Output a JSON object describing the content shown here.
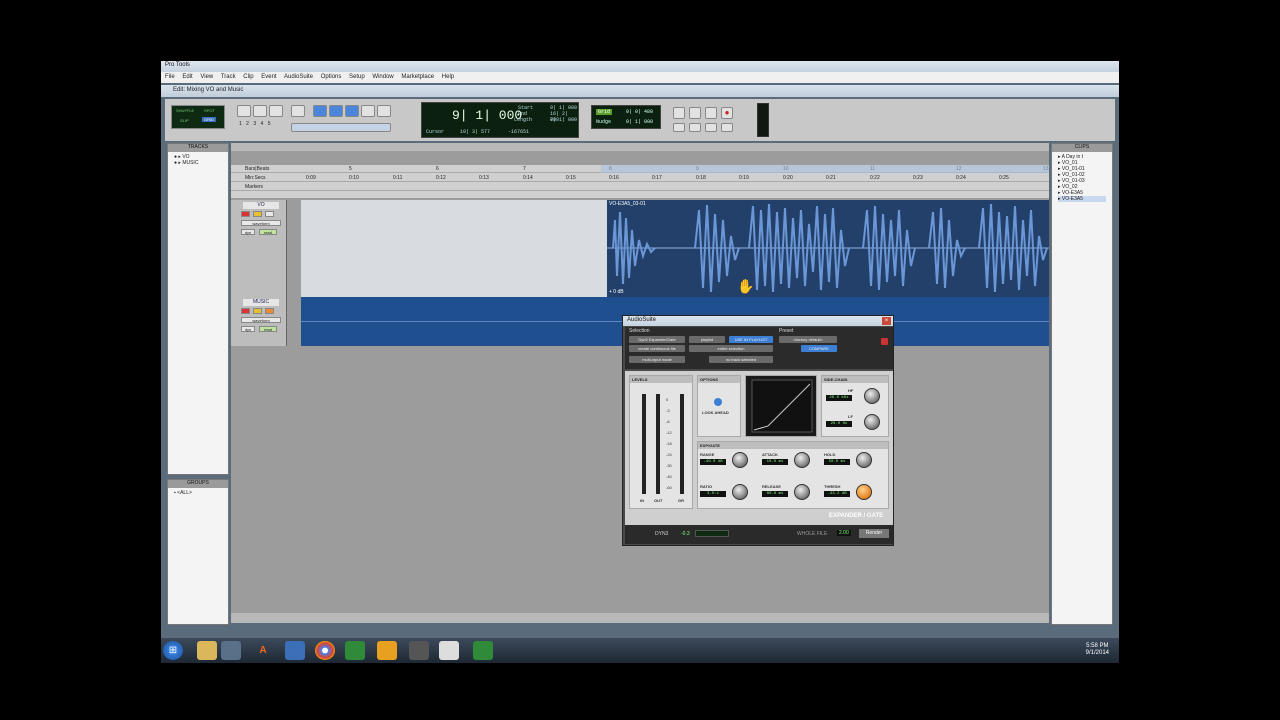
{
  "window": {
    "app_title": "Pro Tools",
    "edit_title": "Edit: Mixing VO and Music"
  },
  "menu": [
    "File",
    "Edit",
    "View",
    "Track",
    "Clip",
    "Event",
    "AudioSuite",
    "Options",
    "Setup",
    "Window",
    "Marketplace",
    "Help"
  ],
  "toolbar": {
    "modes": [
      "SHUFFLE",
      "SPOT",
      "SLIP",
      "GRID"
    ],
    "zoom_presets": [
      "1",
      "2",
      "3",
      "4",
      "5"
    ],
    "main_counter": "9| 1| 000",
    "start_label": "Start",
    "end_label": "End",
    "length_label": "Length",
    "start_value": "9| 1| 000",
    "end_value": "16| 2| 000",
    "length_value": "7| 1| 000",
    "cursor_label": "Cursor",
    "cursor_value": "10| 3| 577",
    "sample_value": "-167651",
    "grid_label": "Grid",
    "grid_value": "0| 0| 480",
    "nudge_label": "Nudge",
    "nudge_value": "0| 1| 000"
  },
  "tracks_panel": {
    "header": "TRACKS",
    "items": [
      "VO",
      "MUSIC"
    ]
  },
  "groups_panel": {
    "header": "GROUPS",
    "items": [
      "<ALL>"
    ]
  },
  "clips_panel": {
    "header": "CLIPS",
    "items": [
      "A Day in t",
      "VO_01",
      "VO_01-01",
      "VO_01-02",
      "VO_01-03",
      "VO_02",
      "VO-E3A5",
      "VO-E3A5"
    ]
  },
  "rulers": {
    "bars_label": "Bars|Beats",
    "minsec_label": "Min:Secs",
    "markers_label": "Markers",
    "bars": [
      "5",
      "6",
      "7",
      "8",
      "9",
      "10",
      "11",
      "12",
      "13"
    ],
    "times": [
      "0:09",
      "0:10",
      "0:11",
      "0:12",
      "0:13",
      "0:14",
      "0:15",
      "0:16",
      "0:17",
      "0:18",
      "0:19",
      "0:20",
      "0:21",
      "0:22",
      "0:23",
      "0:24",
      "0:25"
    ]
  },
  "tracks": [
    {
      "name": "VO",
      "view": "waveform",
      "dyn": "dyn",
      "mode": "read",
      "clip_name": "VO-E3A5_03-01",
      "clip_gain": "+ 0 dB"
    },
    {
      "name": "MUSIC",
      "view": "waveform",
      "dyn": "dyn",
      "mode": "read"
    }
  ],
  "audiosuite": {
    "title": "AudioSuite",
    "selection_label": "Selection",
    "preset_label": "Preset",
    "plugin_name": "Dyn3 Expander/Gate",
    "playlist": "playlist",
    "use_in_playlist": "USE IN PLAYLIST",
    "factory_default": "<factory default>",
    "create_continuous": "create continuous file",
    "entire_selection": "entire selection",
    "compare": "COMPARE",
    "multi_input": "multi-input mode",
    "no_track": "no track selected",
    "levels": "LEVELS",
    "options": "OPTIONS",
    "look_ahead": "LOOK AHEAD",
    "side_chain": "SIDE-CHAIN",
    "hf_label": "HF",
    "hf_value": "20.0 kHz",
    "lf_label": "LF",
    "lf_value": "20.0 Hz",
    "meter_labels": [
      "IN",
      "OUT",
      "GR"
    ],
    "meter_scale": [
      "0",
      "-3",
      "-6",
      "-12",
      "-18",
      "-24",
      "-30",
      "-40",
      "-60"
    ],
    "expgate": "EXP/GATE",
    "range_label": "RANGE",
    "range_value": "-40.0 dB",
    "attack_label": "ATTACK",
    "attack_value": "10.0 ms",
    "hold_label": "HOLD",
    "hold_value": "50.0 ms",
    "ratio_label": "RATIO",
    "ratio_value": "3.0:1",
    "release_label": "RELEASE",
    "release_value": "80.0 ms",
    "thresh_label": "THRESH",
    "thresh_value": "-43.2 dB",
    "brand": "EXPANDER / GATE",
    "footer_dyn": "DYN3",
    "footer_gr": "-0.3",
    "whole_file": "WHOLE FILE",
    "handle_value": "2.00",
    "render": "Render"
  },
  "taskbar": {
    "time": "5:58 PM",
    "date": "9/1/2014"
  },
  "colors": {
    "waveform": "#6b97d6",
    "clip_bg": "#25436c",
    "music_lane": "#1f4f8f",
    "thresh_knob": "#e6801f"
  }
}
